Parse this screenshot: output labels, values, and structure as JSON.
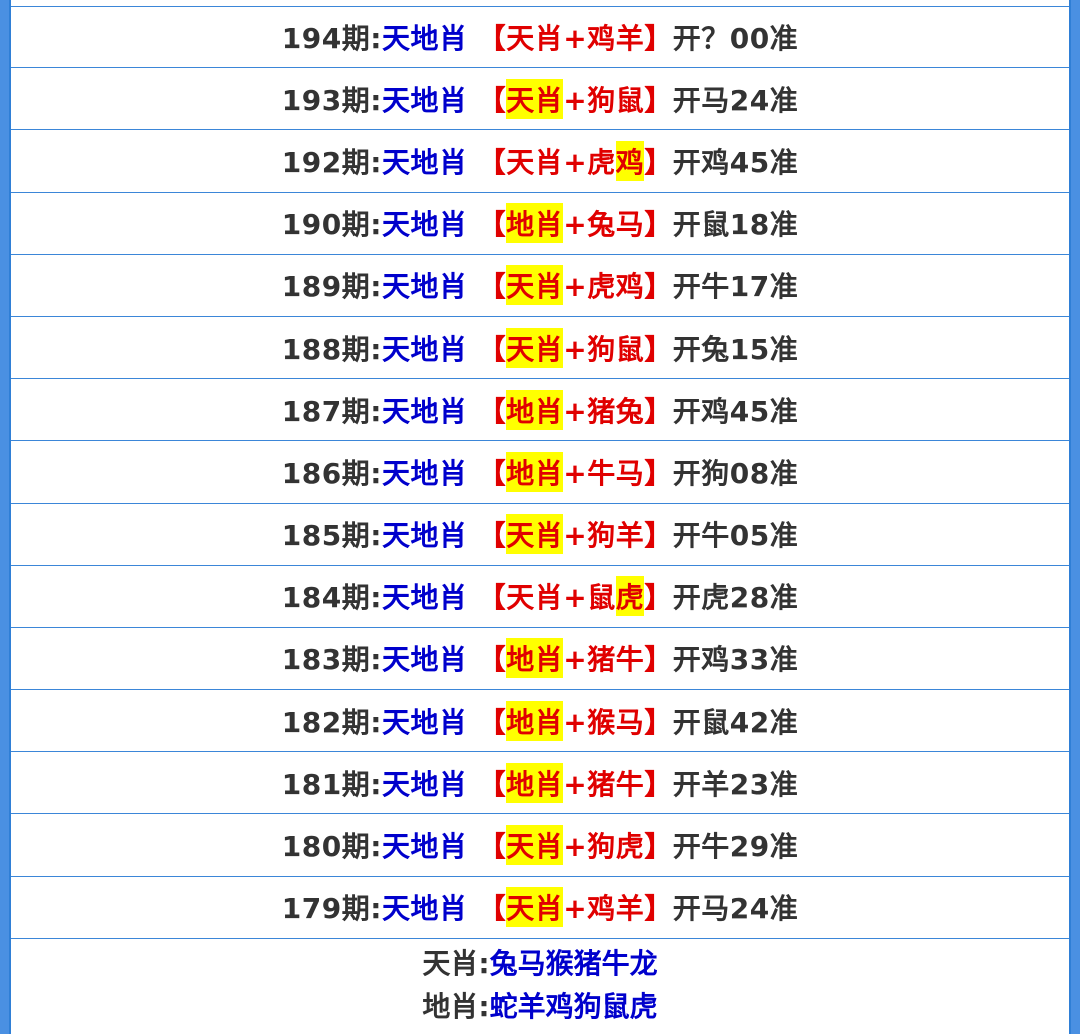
{
  "rows": [
    {
      "period": "194期:",
      "label": "天地肖",
      "open": "【",
      "hl": "",
      "rest": "天肖+鸡羊",
      "close": "】",
      "result": "开？00准"
    },
    {
      "period": "193期:",
      "label": "天地肖",
      "open": "【",
      "hl": "天肖",
      "rest": "+狗鼠",
      "close": "】",
      "result": "开马24准"
    },
    {
      "period": "192期:",
      "label": "天地肖",
      "open": "【",
      "pre": "天肖+虎",
      "hl": "鸡",
      "rest": "",
      "close": "】",
      "result": "开鸡45准"
    },
    {
      "period": "190期:",
      "label": "天地肖",
      "open": "【",
      "hl": "地肖",
      "rest": "+兔马",
      "close": "】",
      "result": "开鼠18准"
    },
    {
      "period": "189期:",
      "label": "天地肖",
      "open": "【",
      "hl": "天肖",
      "rest": "+虎鸡",
      "close": "】",
      "result": "开牛17准"
    },
    {
      "period": "188期:",
      "label": "天地肖",
      "open": "【",
      "hl": "天肖",
      "rest": "+狗鼠",
      "close": "】",
      "result": "开兔15准"
    },
    {
      "period": "187期:",
      "label": "天地肖",
      "open": "【",
      "hl": "地肖",
      "rest": "+猪兔",
      "close": "】",
      "result": "开鸡45准"
    },
    {
      "period": "186期:",
      "label": "天地肖",
      "open": "【",
      "hl": "地肖",
      "rest": "+牛马",
      "close": "】",
      "result": "开狗08准"
    },
    {
      "period": "185期:",
      "label": "天地肖",
      "open": "【",
      "hl": "天肖",
      "rest": "+狗羊",
      "close": "】",
      "result": "开牛05准"
    },
    {
      "period": "184期:",
      "label": "天地肖",
      "open": "【",
      "pre": "天肖+鼠",
      "hl": "虎",
      "rest": "",
      "close": "】",
      "result": "开虎28准"
    },
    {
      "period": "183期:",
      "label": "天地肖",
      "open": "【",
      "hl": "地肖",
      "rest": "+猪牛",
      "close": "】",
      "result": "开鸡33准"
    },
    {
      "period": "182期:",
      "label": "天地肖",
      "open": "【",
      "hl": "地肖",
      "rest": "+猴马",
      "close": "】",
      "result": "开鼠42准"
    },
    {
      "period": "181期:",
      "label": "天地肖",
      "open": "【",
      "hl": "地肖",
      "rest": "+猪牛",
      "close": "】",
      "result": "开羊23准"
    },
    {
      "period": "180期:",
      "label": "天地肖",
      "open": "【",
      "hl": "天肖",
      "rest": "+狗虎",
      "close": "】",
      "result": "开牛29准"
    },
    {
      "period": "179期:",
      "label": "天地肖",
      "open": "【",
      "hl": "天肖",
      "rest": "+鸡羊",
      "close": "】",
      "result": "开马24准"
    }
  ],
  "legend": {
    "tian_key": "天肖:",
    "tian_val": "兔马猴猪牛龙",
    "di_key": "地肖:",
    "di_val": "蛇羊鸡狗鼠虎"
  },
  "colors": {
    "period": "#333333",
    "label": "#0000cc",
    "pick": "#e00000",
    "highlight": "#ffff00",
    "border": "#3b86d8",
    "outer": "#4a90e2"
  }
}
